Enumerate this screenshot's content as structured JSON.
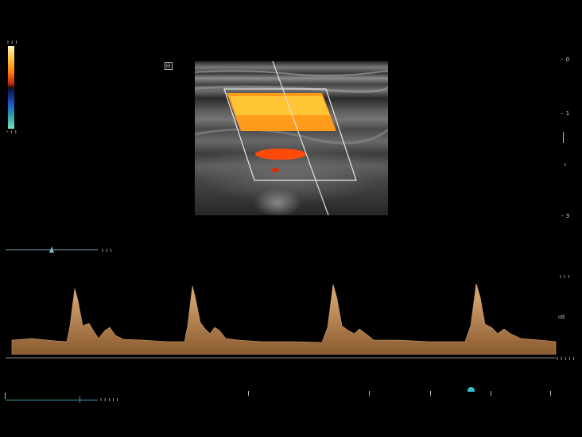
{
  "colorbar": {
    "top_label": "ı ı ı",
    "bottom_label": "- ı ı"
  },
  "bmode_marker": "⊟",
  "depth_scale": {
    "labels": [
      "- 0",
      "- 1",
      "ı",
      "- 3"
    ]
  },
  "baseline_slider": {
    "label": "ı ı ı"
  },
  "velocity_scale": {
    "labels": [
      "ı ı ı",
      "ı⊟"
    ],
    "baseline_label": "ı ı ı ı ı"
  },
  "timeline": {
    "label": "ı ı ı ı ı"
  },
  "colors": {
    "doppler_high": "#ffc23a",
    "doppler_mid": "#ff6a10",
    "spectral": "#c8955a",
    "accent": "#39c0d8"
  }
}
